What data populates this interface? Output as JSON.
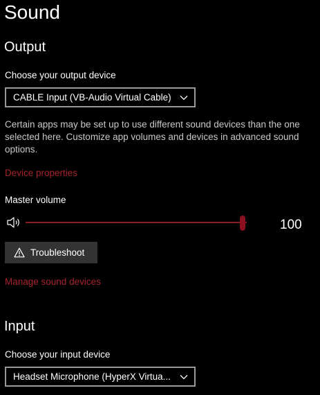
{
  "page": {
    "title": "Sound"
  },
  "output": {
    "heading": "Output",
    "device_label": "Choose your output device",
    "device_value": "CABLE Input (VB-Audio Virtual Cable)",
    "description": "Certain apps may be set up to use different sound devices than the one selected here. Customize app volumes and devices in advanced sound options.",
    "device_properties_link": "Device properties",
    "master_volume_label": "Master volume",
    "master_volume_value": "100",
    "master_volume_level": 100,
    "troubleshoot_label": "Troubleshoot",
    "manage_devices_link": "Manage sound devices"
  },
  "input": {
    "heading": "Input",
    "device_label": "Choose your input device",
    "device_value": "Headset Microphone (HyperX Virtua..."
  },
  "icons": {
    "speaker": "speaker-icon",
    "chevron": "chevron-down-icon",
    "warning": "warning-icon"
  },
  "colors": {
    "accent": "#8b1c27",
    "link": "#a5232d",
    "background": "#000000",
    "text": "#ffffff",
    "button_bg": "#333333"
  }
}
